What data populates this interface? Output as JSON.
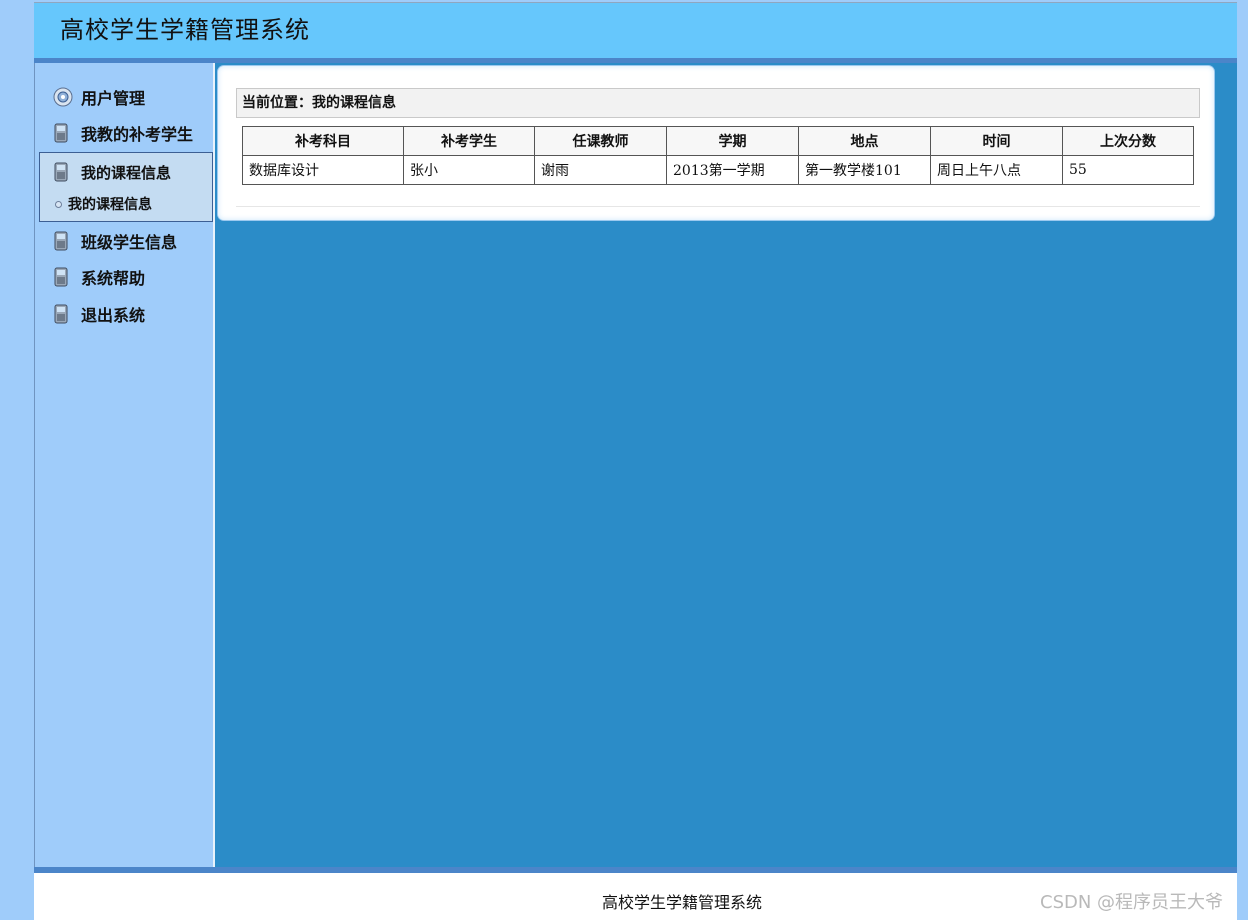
{
  "header": {
    "title": "高校学生学籍管理系统"
  },
  "sidebar": {
    "items": [
      {
        "label": "用户管理",
        "icon": "disc-icon"
      },
      {
        "label": "我教的补考学生",
        "icon": "phone-icon"
      },
      {
        "label": "我的课程信息",
        "icon": "phone-icon"
      },
      {
        "label": "班级学生信息",
        "icon": "phone-icon"
      },
      {
        "label": "系统帮助",
        "icon": "phone-icon"
      },
      {
        "label": "退出系统",
        "icon": "phone-icon"
      }
    ],
    "sub_item": "我的课程信息"
  },
  "main": {
    "breadcrumb": "当前位置：我的课程信息",
    "table": {
      "headers": [
        "补考科目",
        "补考学生",
        "任课教师",
        "学期",
        "地点",
        "时间",
        "上次分数"
      ],
      "rows": [
        [
          "数据库设计",
          "张小",
          "谢雨",
          "2013第一学期",
          "第一教学楼101",
          "周日上午八点",
          "55"
        ]
      ]
    }
  },
  "footer": {
    "text": "高校学生学籍管理系统"
  },
  "watermark": "CSDN @程序员王大爷",
  "colors": {
    "header_bg": "#66c7fc",
    "sidebar_bg": "#9fccfa",
    "content_bg": "#2b8cc8",
    "bar": "#4b85c9"
  }
}
